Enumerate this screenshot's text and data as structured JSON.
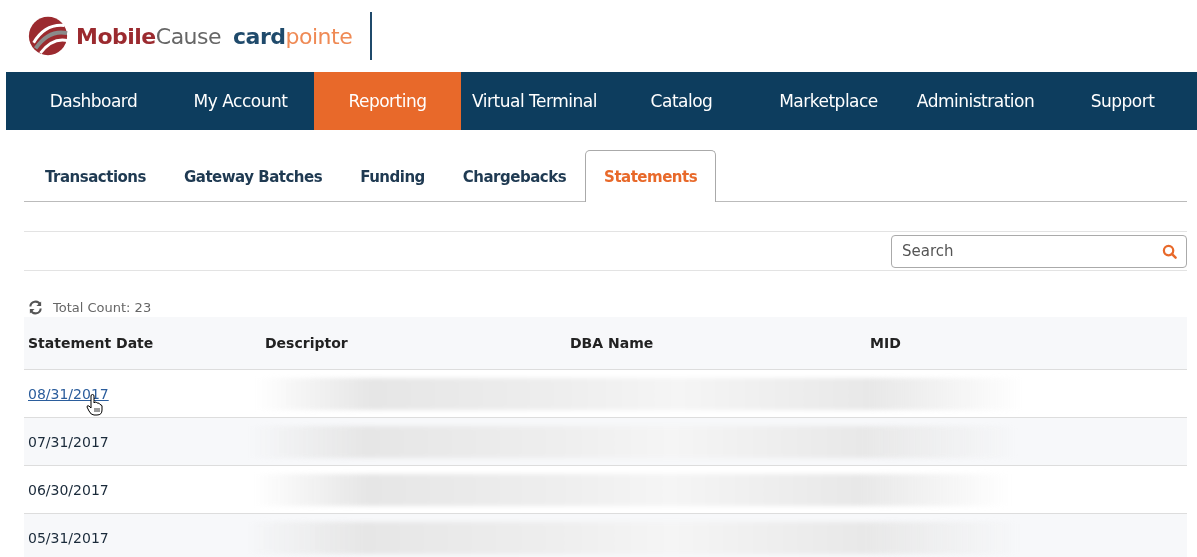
{
  "logos": [
    {
      "strong": "Mobile",
      "light": "Cause",
      "kind": "mobilecause"
    },
    {
      "strong": "card",
      "light": "pointe",
      "kind": "cardpointe"
    }
  ],
  "nav": [
    {
      "label": "Dashboard",
      "selected": false
    },
    {
      "label": "My Account",
      "selected": false
    },
    {
      "label": "Reporting",
      "selected": true
    },
    {
      "label": "Virtual Terminal",
      "selected": false
    },
    {
      "label": "Catalog",
      "selected": false
    },
    {
      "label": "Marketplace",
      "selected": false
    },
    {
      "label": "Administration",
      "selected": false
    },
    {
      "label": "Support",
      "selected": false
    }
  ],
  "tabs": [
    {
      "label": "Transactions",
      "selected": false
    },
    {
      "label": "Gateway Batches",
      "selected": false
    },
    {
      "label": "Funding",
      "selected": false
    },
    {
      "label": "Chargebacks",
      "selected": false
    },
    {
      "label": "Statements",
      "selected": true
    }
  ],
  "search": {
    "placeholder": "Search"
  },
  "total_count": "Total Count: 23",
  "table": {
    "columns": [
      "Statement Date",
      "Descriptor",
      "DBA Name",
      "MID"
    ],
    "rows": [
      {
        "date": "08/31/2017",
        "hovered": true
      },
      {
        "date": "07/31/2017",
        "hovered": false
      },
      {
        "date": "06/30/2017",
        "hovered": false
      },
      {
        "date": "05/31/2017",
        "hovered": false
      }
    ]
  }
}
